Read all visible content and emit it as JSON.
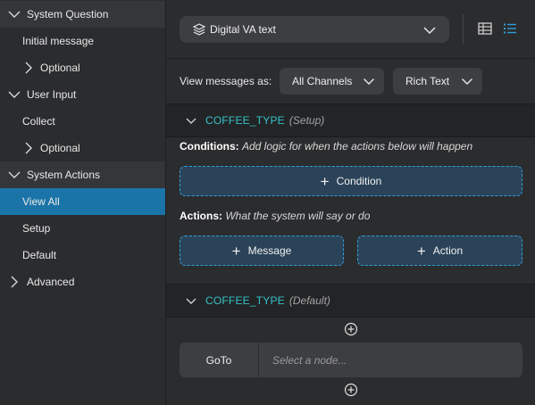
{
  "sidebar": {
    "items": [
      {
        "label": "System Question",
        "type": "section",
        "expanded": true
      },
      {
        "label": "Initial message",
        "type": "child"
      },
      {
        "label": "Optional",
        "type": "sub",
        "expanded": false
      },
      {
        "label": "User Input",
        "type": "plain",
        "expanded": true
      },
      {
        "label": "Collect",
        "type": "child"
      },
      {
        "label": "Optional",
        "type": "sub",
        "expanded": false
      },
      {
        "label": "System Actions",
        "type": "section",
        "expanded": true
      },
      {
        "label": "View All",
        "type": "active"
      },
      {
        "label": "Setup",
        "type": "child"
      },
      {
        "label": "Default",
        "type": "child"
      },
      {
        "label": "Advanced",
        "type": "plain",
        "expanded": false
      }
    ]
  },
  "toolbar": {
    "dropdown_label": "Digital VA text",
    "layer_icon": "layers-icon",
    "table_icon": "table-view-icon",
    "list_icon": "list-view-icon",
    "active_view": "list"
  },
  "view": {
    "label": "View messages as:",
    "channels": "All Channels",
    "format": "Rich Text"
  },
  "blocks": [
    {
      "name": "COFFEE_TYPE",
      "suffix": "(Setup)",
      "conditions_title": "Conditions:",
      "conditions_desc": "Add logic for when the actions below will happen",
      "condition_button": "Condition",
      "actions_title": "Actions:",
      "actions_desc": "What the system will say or do",
      "message_button": "Message",
      "action_button": "Action"
    },
    {
      "name": "COFFEE_TYPE",
      "suffix": "(Default)"
    }
  ],
  "goto": {
    "label": "GoTo",
    "placeholder": "Select a node..."
  },
  "colors": {
    "accent": "#1b74a8",
    "teal": "#35c2c8",
    "dashed_border": "#2f9dd8"
  }
}
